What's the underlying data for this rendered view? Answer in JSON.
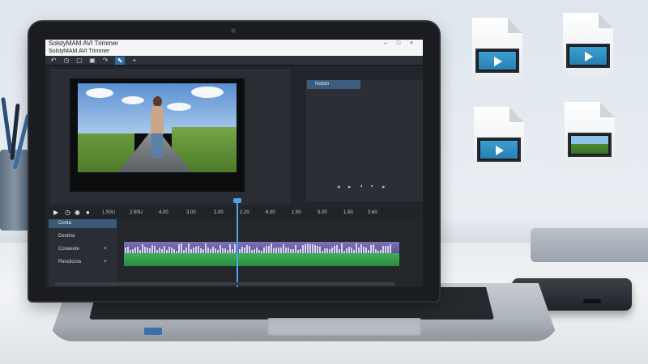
{
  "app": {
    "window_title": "SolstyMAM AVI Trimmer",
    "window_subtitle": "SolstyMAM AVI Trimmer",
    "window_controls": {
      "minimize": "–",
      "maximize": "□",
      "close": "×"
    },
    "toolbar": {
      "tools": [
        {
          "icon": "undo-icon",
          "glyph": "↶"
        },
        {
          "icon": "clock-icon",
          "glyph": "◷"
        },
        {
          "icon": "screen-icon",
          "glyph": "▢"
        },
        {
          "icon": "square-icon",
          "glyph": "▣"
        },
        {
          "icon": "redo-icon",
          "glyph": "↷"
        },
        {
          "icon": "select-icon",
          "glyph": "⬉",
          "active": true
        },
        {
          "icon": "add-icon",
          "glyph": "+"
        }
      ]
    },
    "right_panel": {
      "tab_label": "Notion"
    },
    "preview_controls": [
      "◂",
      "▸",
      "◖",
      "▪",
      "▸"
    ],
    "transport": {
      "play": "▶",
      "buttons": [
        "◷",
        "◉",
        "●"
      ],
      "ruler": [
        "1.50U",
        "2.50U",
        "4.00",
        "3.00",
        "2.00",
        "2.20",
        "6.00",
        "1.50",
        "5.00",
        "1.50",
        "3.60"
      ]
    },
    "timeline": {
      "header": "Conta",
      "tracks": [
        {
          "label": "Destina",
          "plus": ""
        },
        {
          "label": "Coraieote",
          "plus": "+"
        },
        {
          "label": "Penclicora",
          "plus": "+"
        }
      ]
    }
  },
  "colors": {
    "accent": "#2f6da8",
    "video_clip": "#6e67aa",
    "audio_clip": "#36a04d",
    "playhead": "#4fa3e8"
  }
}
